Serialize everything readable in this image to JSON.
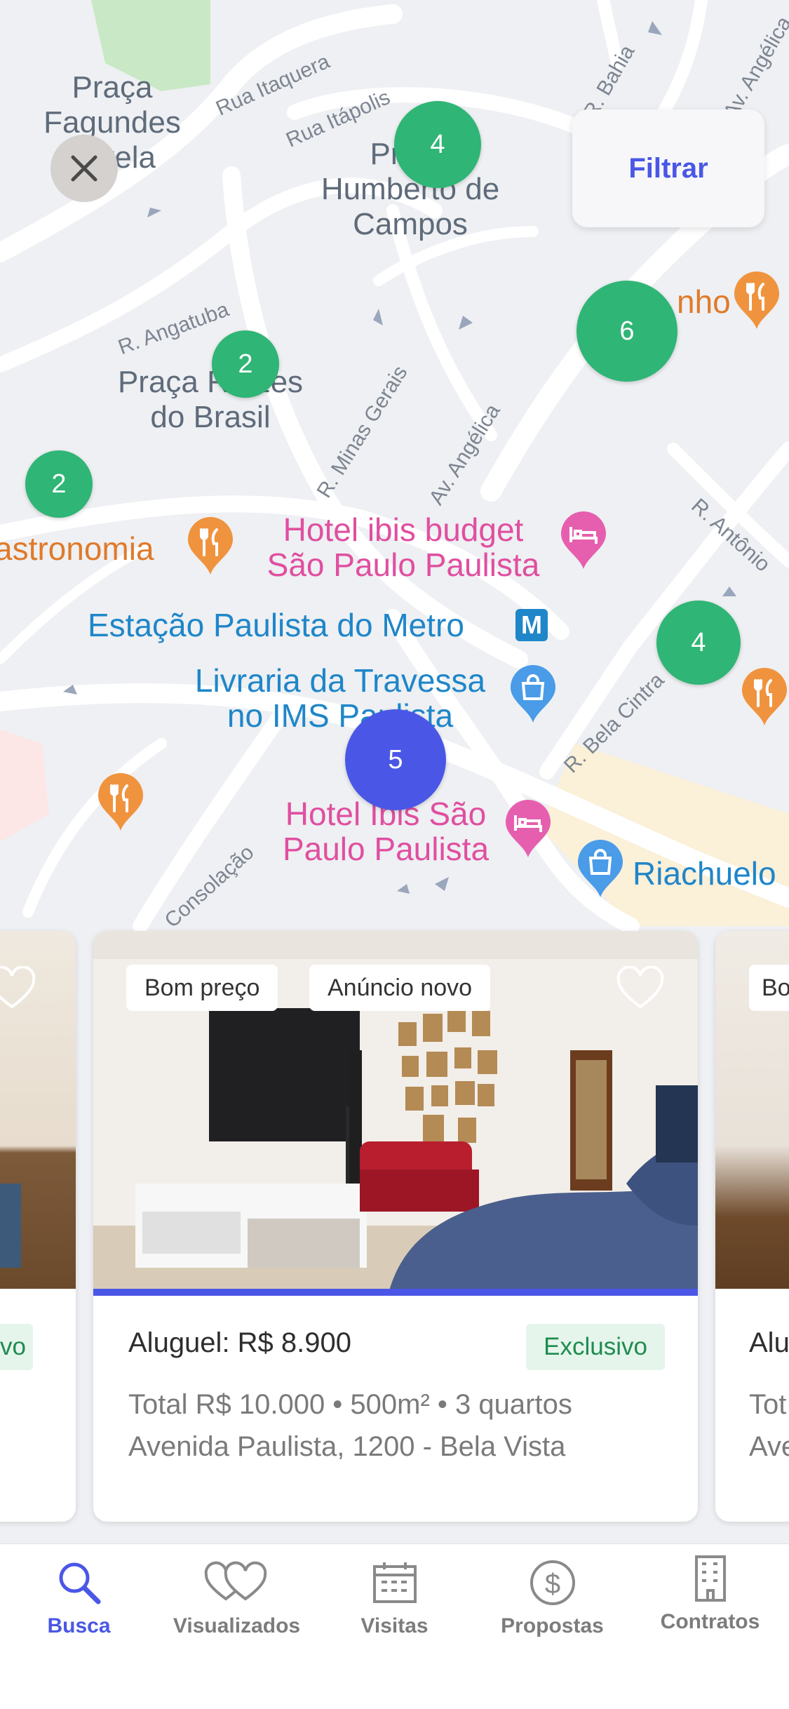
{
  "map": {
    "places": [
      "Praça Fagundes Varela",
      "Praça Humberto de Campos",
      "Praça Raízes do Brasil"
    ],
    "streets": [
      "Rua Itaquera",
      "Rua Itápolis",
      "R. Bahia",
      "Av. Angélica",
      "R. Angatuba",
      "R. Minas Gerais",
      "Av. Angélica",
      "R. Antônio",
      "R. Bela Cintra",
      "Consolação"
    ],
    "pois": {
      "hotel_ibis_budget": "Hotel ibis budget\nSão Paulo Paulista",
      "metro": "Estação Paulista do Metro",
      "livraria": "Livraria da Travessa\nno IMS Paulista",
      "hotel_ibis": "Hotel Ibis São\nPaulo Paulista",
      "riachuelo": "Riachuelo",
      "gastronomia": "astronomia",
      "restaurant_top": "nho"
    },
    "clusters": [
      {
        "id": "c1",
        "count": "4",
        "color": "green"
      },
      {
        "id": "c2",
        "count": "6",
        "color": "green"
      },
      {
        "id": "c3",
        "count": "2",
        "color": "green"
      },
      {
        "id": "c4",
        "count": "2",
        "color": "green"
      },
      {
        "id": "c5",
        "count": "4",
        "color": "green"
      },
      {
        "id": "c6",
        "count": "5",
        "color": "blue"
      }
    ]
  },
  "filter_label": "Filtrar",
  "cards": {
    "left": {
      "badge_partial": "vo"
    },
    "main": {
      "tags": [
        "Bom preço",
        "Anúncio novo"
      ],
      "price": "Aluguel: R$ 8.900",
      "badge": "Exclusivo",
      "details_line1": "Total R$ 10.000 • 500m² • 3 quartos",
      "details_line2": "Avenida Paulista, 1200 - Bela Vista",
      "photo_progress": 1.0
    },
    "right": {
      "tag_partial": "Bo",
      "price_partial": "Alu",
      "details_line1_partial": "Tot",
      "details_line2_partial": "Ave"
    }
  },
  "tabs": [
    {
      "label": "Busca",
      "icon": "search-icon",
      "active": true
    },
    {
      "label": "Visualizados",
      "icon": "hearts-icon",
      "active": false
    },
    {
      "label": "Visitas",
      "icon": "calendar-icon",
      "active": false
    },
    {
      "label": "Propostas",
      "icon": "dollar-icon",
      "active": false
    },
    {
      "label": "Contratos",
      "icon": "building-icon",
      "active": false
    }
  ],
  "colors": {
    "accent": "#4a57e6",
    "cluster_green": "#2fb575",
    "badge_green": "#1e8c50"
  }
}
